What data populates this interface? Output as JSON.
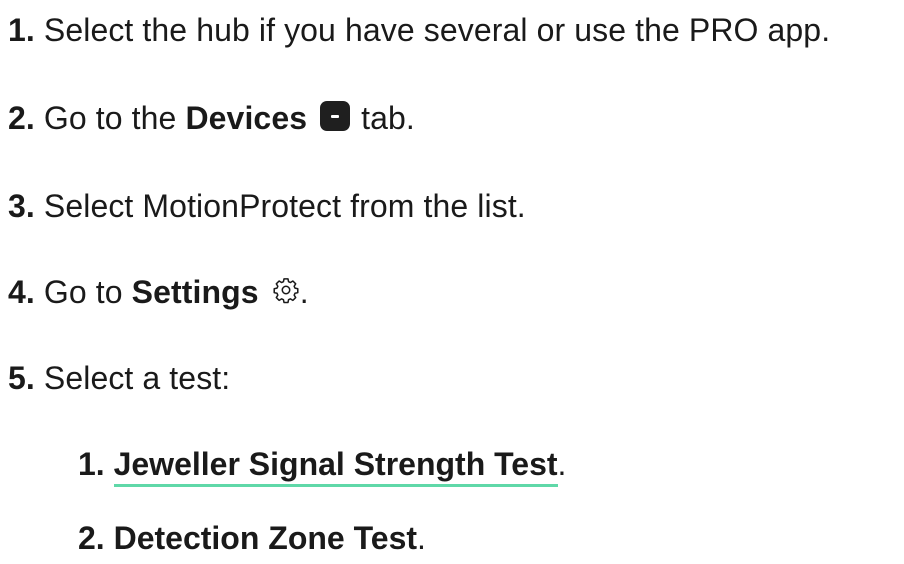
{
  "steps": [
    {
      "num": "1.",
      "text": "Select the hub if you have several or use the PRO app."
    },
    {
      "num": "2.",
      "pre": "Go to the",
      "strong": "Devices",
      "post": "tab.",
      "icon": "devices-tab-icon"
    },
    {
      "num": "3.",
      "text": "Select MotionProtect from the list."
    },
    {
      "num": "4.",
      "pre": "Go to",
      "strong": "Settings",
      "post": ".",
      "icon": "gear-icon"
    },
    {
      "num": "5.",
      "text": "Select a test:"
    }
  ],
  "tests": [
    {
      "num": "1.",
      "label": "Jeweller Signal Strength Test",
      "post": "."
    },
    {
      "num": "2.",
      "label": "Detection Zone Test",
      "post": "."
    }
  ],
  "colors": {
    "link_underline": "#5fd8a8",
    "text": "#1a1a1a",
    "icon_bg": "#1f1f1f"
  }
}
